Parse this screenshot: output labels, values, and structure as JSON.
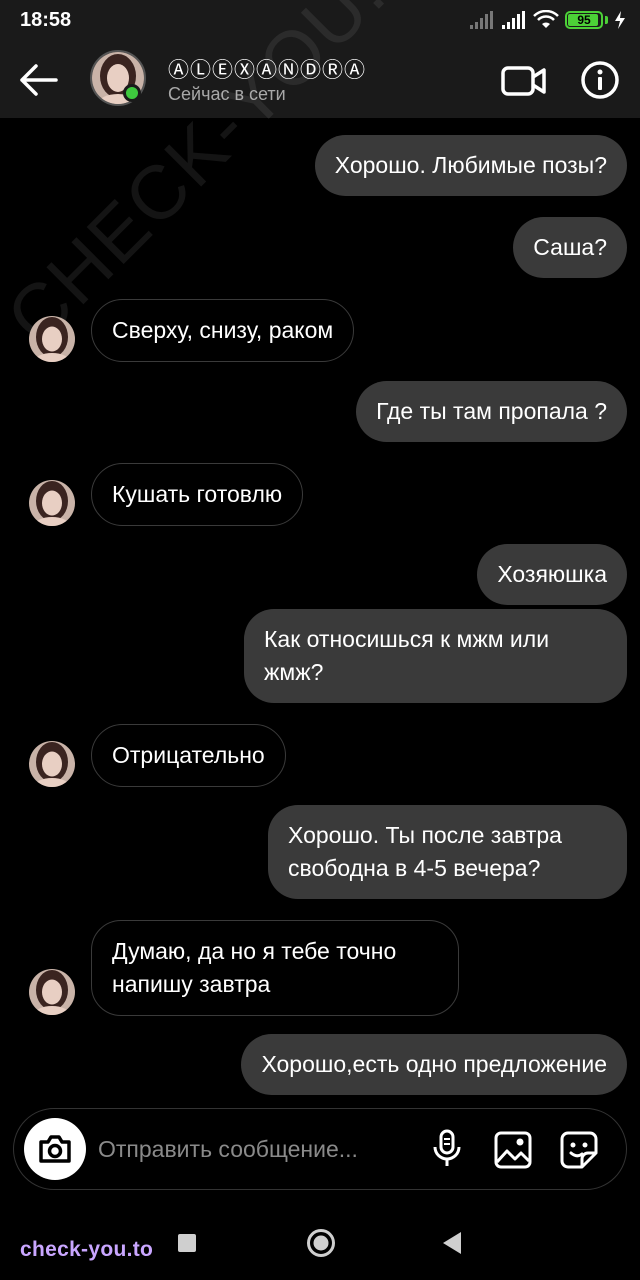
{
  "status_bar": {
    "time": "18:58",
    "battery": "95",
    "battery_level": 0.95,
    "icons": [
      "signal-icon",
      "signal-icon",
      "wifi-icon",
      "battery-icon",
      "charging-icon"
    ]
  },
  "header": {
    "name": "ⒶⓁⒺⓍⒶⓃⒹⓇⒶ",
    "status": "Сейчас в сети",
    "icons": [
      "back-arrow-icon",
      "video-call-icon",
      "info-icon"
    ]
  },
  "messages": [
    {
      "dir": "out",
      "text": "Хорошо. Любимые позы?"
    },
    {
      "dir": "out",
      "text": "Саша?"
    },
    {
      "dir": "in",
      "text": "Сверху, снизу, раком"
    },
    {
      "dir": "out",
      "text": "Где ты там пропала ?"
    },
    {
      "dir": "in",
      "text": "Кушать готовлю"
    },
    {
      "dir": "out",
      "text": "Хозяюшка"
    },
    {
      "dir": "out",
      "text": "Как относишься к мжм или жмж?"
    },
    {
      "dir": "in",
      "text": "Отрицательно"
    },
    {
      "dir": "out",
      "text": "Хорошо. Ты после завтра свободна в 4-5 вечера?"
    },
    {
      "dir": "in",
      "text": "Думаю, да но я тебе точно напишу завтра"
    },
    {
      "dir": "out",
      "text": "Хорошо,есть одно предложение"
    }
  ],
  "composer": {
    "placeholder": "Отправить сообщение...",
    "icons": [
      "camera-icon",
      "microphone-icon",
      "gallery-icon",
      "sticker-icon"
    ]
  },
  "watermark": {
    "bottom": "check-you.to",
    "diagonal": "CHECK-YOU.ME"
  },
  "colors": {
    "outgoing_bubble": "#3a3a3a",
    "online": "#3ec93e",
    "battery": "#4cd137",
    "watermark": "#c9a6ff"
  }
}
